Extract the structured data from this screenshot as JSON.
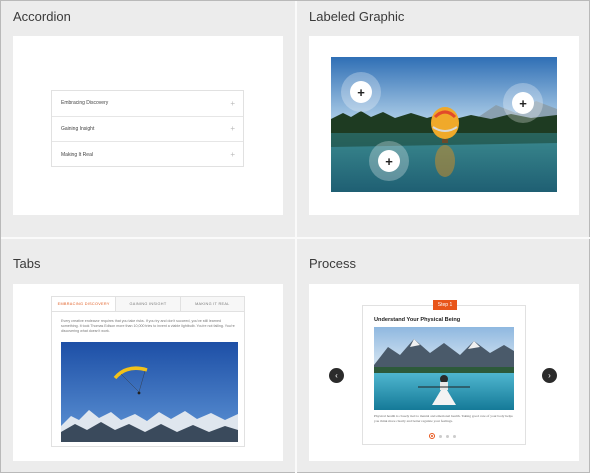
{
  "quadrants": {
    "accordion": {
      "title": "Accordion",
      "items": [
        {
          "label": "Embracing Discovery",
          "icon": "+"
        },
        {
          "label": "Gaining Insight",
          "icon": "+"
        },
        {
          "label": "Making It Real",
          "icon": "+"
        }
      ]
    },
    "labeled_graphic": {
      "title": "Labeled Graphic",
      "hotspot_icon": "+"
    },
    "tabs": {
      "title": "Tabs",
      "tabs": [
        "EMBRACING DISCOVERY",
        "GAINING INSIGHT",
        "MAKING IT REAL"
      ],
      "body": "Every creative endeavor requires that you take risks. If you try and don't succeed, you've still learned something. It took Thomas Edison more than 10,000 tries to invent a viable lightbulb. You're not failing. You're discovering what doesn't work."
    },
    "process": {
      "title": "Process",
      "step_badge": "Step 1",
      "step_title": "Understand Your Physical Being",
      "step_text": "Physical health is closely tied to mental and emotional health. Taking good care of your body helps you think more clearly and better regulate your feelings.",
      "prev_icon": "‹",
      "next_icon": "›"
    }
  },
  "colors": {
    "accent": "#e8551a",
    "background": "#ececec",
    "card": "#ffffff"
  }
}
